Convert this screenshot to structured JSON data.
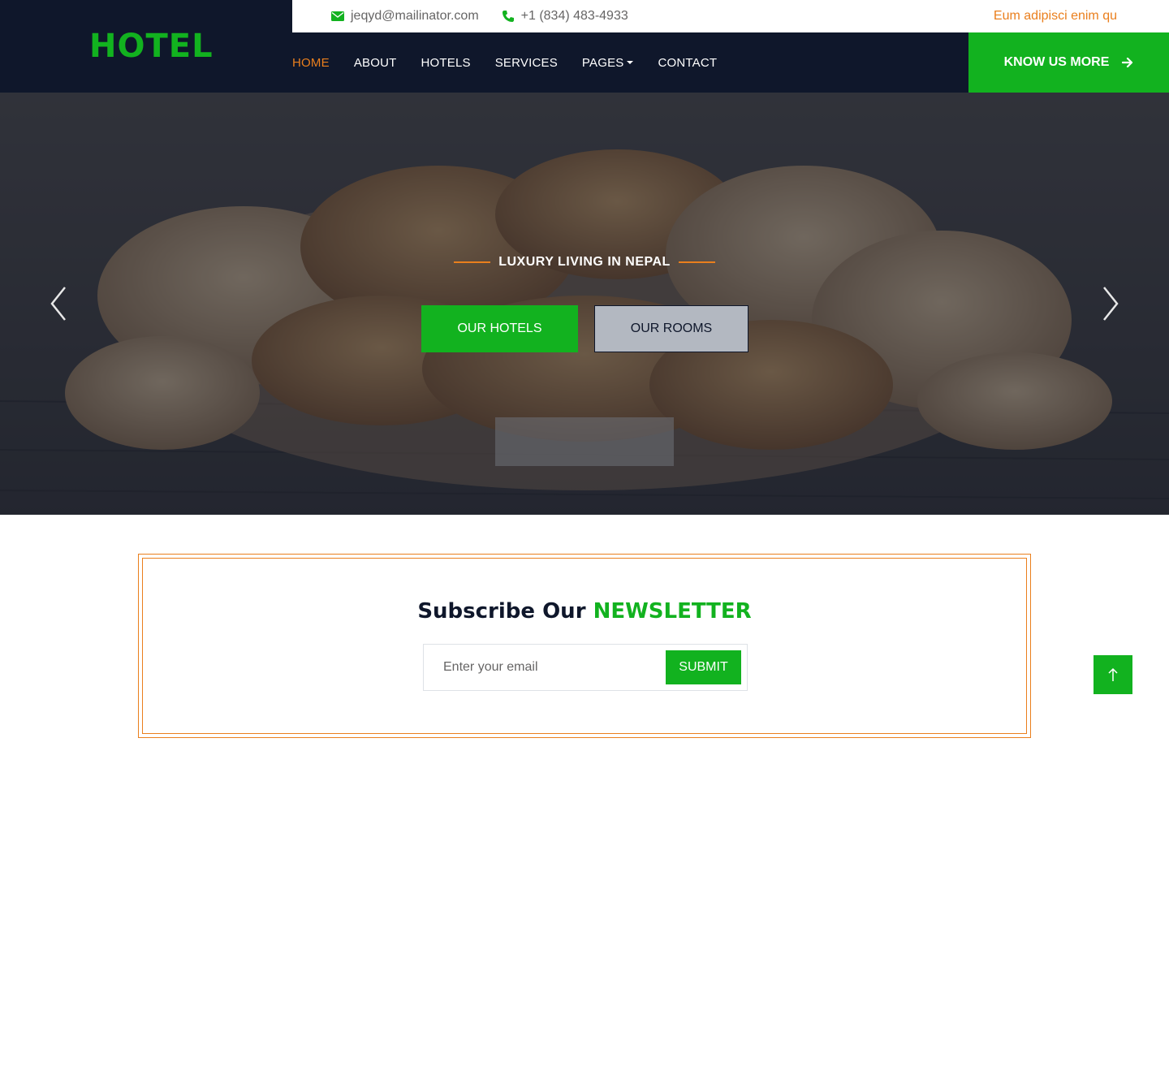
{
  "brand": {
    "name": "HOTEL"
  },
  "topbar": {
    "email": "jeqyd@mailinator.com",
    "phone": "+1 (834) 483-4933",
    "ticker": "Eum adipisci enim qu"
  },
  "nav": {
    "items": [
      {
        "label": "HOME",
        "active": true
      },
      {
        "label": "ABOUT"
      },
      {
        "label": "HOTELS"
      },
      {
        "label": "SERVICES"
      },
      {
        "label": "PAGES"
      },
      {
        "label": "CONTACT"
      }
    ],
    "cta_label": "KNOW US MORE"
  },
  "hero": {
    "tagline": "LUXURY LIVING IN NEPAL",
    "primary_button": "OUR HOTELS",
    "secondary_button": "OUR ROOMS"
  },
  "newsletter": {
    "title": "Subscribe Our",
    "title_accent": "NEWSLETTER",
    "placeholder": "Enter your email",
    "submit_label": "SUBMIT"
  },
  "icons": {
    "email": "envelope-icon",
    "phone": "phone-icon",
    "cta": "arrow-right-icon",
    "prev": "chevron-left-icon",
    "next": "chevron-right-icon",
    "back_to_top": "arrow-up-icon"
  },
  "colors": {
    "brand_green": "#12b21f",
    "accent_orange": "#ea7f1d",
    "dark_navy": "#0f172b"
  }
}
